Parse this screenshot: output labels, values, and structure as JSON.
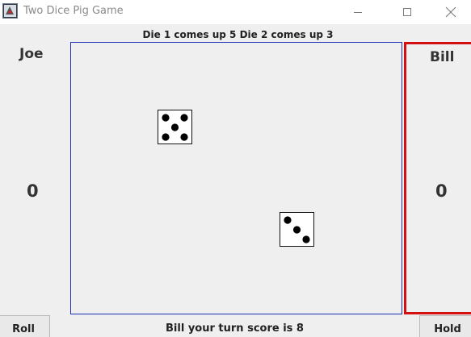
{
  "window": {
    "title": "Two Dice Pig Game",
    "icon": "app-icon",
    "controls": {
      "minimize_icon": "minimize-icon",
      "maximize_icon": "maximize-icon",
      "close_icon": "close-icon"
    }
  },
  "status": {
    "top_message": "Die 1 comes up 5 Die 2 comes up 3",
    "bottom_message": "Bill your turn score is 8"
  },
  "players": [
    {
      "name": "Joe",
      "score": "0"
    },
    {
      "name": "Bill",
      "score": "0",
      "active": true
    }
  ],
  "dice": [
    {
      "label": "die 1",
      "value": 5
    },
    {
      "label": "die 2",
      "value": 3
    }
  ],
  "buttons": {
    "roll_label": "Roll",
    "hold_label": "Hold"
  },
  "colors": {
    "board_border": "#1d2fb5",
    "active_player_border": "#d40f0f",
    "pip": "#000000"
  }
}
